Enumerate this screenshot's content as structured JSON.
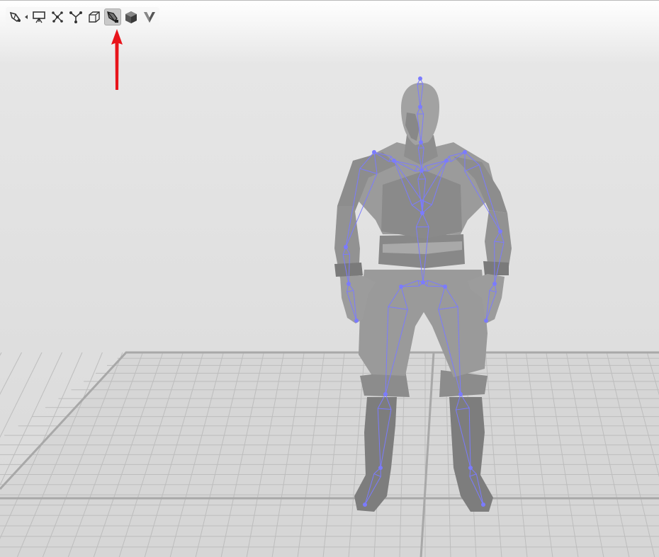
{
  "toolbar": {
    "tools": [
      {
        "icon": "skin-weight-pen-icon",
        "active": false,
        "has_dropdown": true
      },
      {
        "icon": "presentation-board-icon",
        "active": false
      },
      {
        "icon": "bone-joints-icon",
        "active": false
      },
      {
        "icon": "vertex-tree-icon",
        "active": false
      },
      {
        "icon": "wireframe-cube-icon",
        "active": false
      },
      {
        "icon": "skeleton-view-icon",
        "active": true
      },
      {
        "icon": "solid-cube-icon",
        "active": false
      },
      {
        "icon": "shaded-shape-icon",
        "active": false
      }
    ]
  },
  "scene": {
    "model": "character-mesh-with-skeleton",
    "colors": {
      "mesh": "#8f8f8f",
      "mesh_light": "#a6a6a6",
      "mesh_dark": "#6f6f6f",
      "skeleton": "#7b7bff",
      "grid": "#bdbdbd",
      "grid_major": "#a8a8a8",
      "floor": "#d6d6d6"
    }
  },
  "annotation": {
    "color": "#e8141b",
    "points_to": "skeleton-view-icon"
  }
}
